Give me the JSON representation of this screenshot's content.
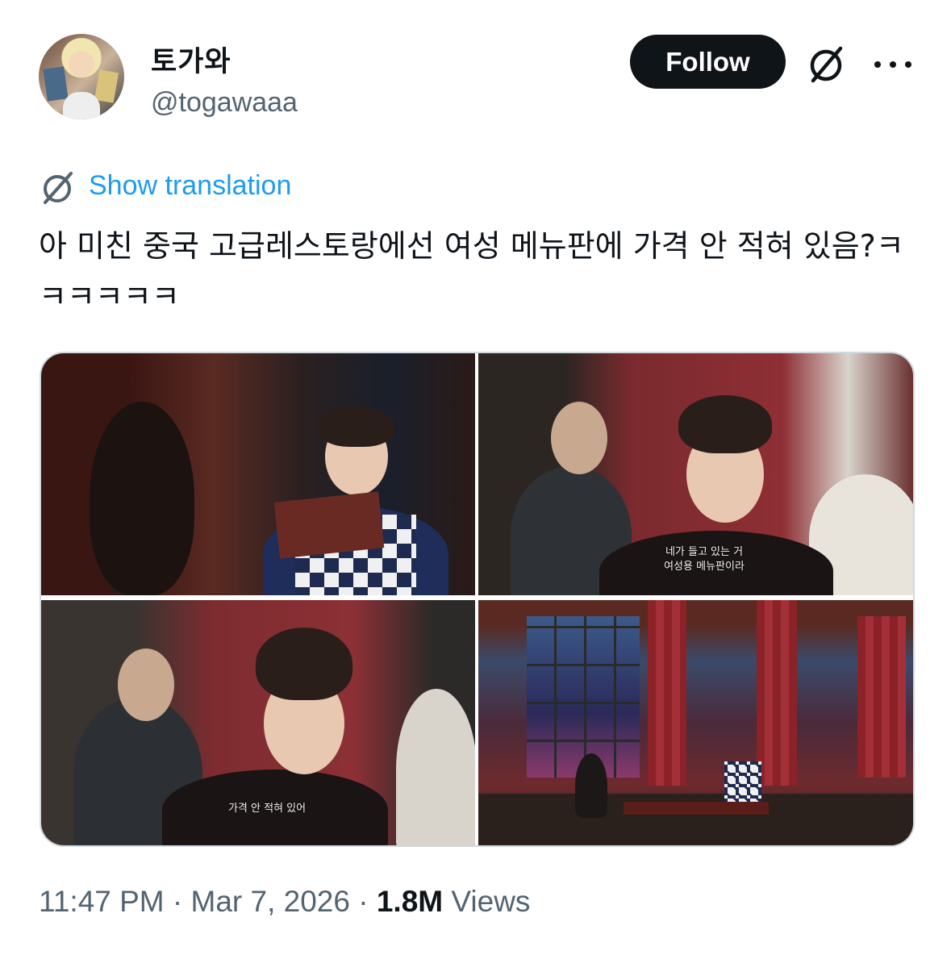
{
  "author": {
    "display_name": "토가와",
    "handle": "@togawaaa"
  },
  "header": {
    "follow_label": "Follow",
    "grok_icon": "grok-slash-circle-icon",
    "more_icon": "more-dots-icon"
  },
  "translation": {
    "icon": "grok-translate-icon",
    "label": "Show translation"
  },
  "tweet": {
    "text": "아 미친 중국 고급레스토랑에선 여성 메뉴판에 가격 안 적혀 있음?ㅋㅋㅋㅋㅋㅋ"
  },
  "media": {
    "photos": [
      {
        "subtitle": ""
      },
      {
        "subtitle_line1": "네가 들고 있는 거",
        "subtitle_line2": "여성용 메뉴판이라"
      },
      {
        "subtitle": "가격 안 적혀 있어"
      },
      {
        "subtitle": ""
      }
    ]
  },
  "meta": {
    "time": "11:47 PM",
    "separator": "·",
    "date": "Mar 7, 2026",
    "views_count": "1.8M",
    "views_label": "Views"
  },
  "colors": {
    "accent": "#1d9bf0",
    "text_primary": "#0f1419",
    "text_secondary": "#536471",
    "border": "#cfd9de"
  }
}
